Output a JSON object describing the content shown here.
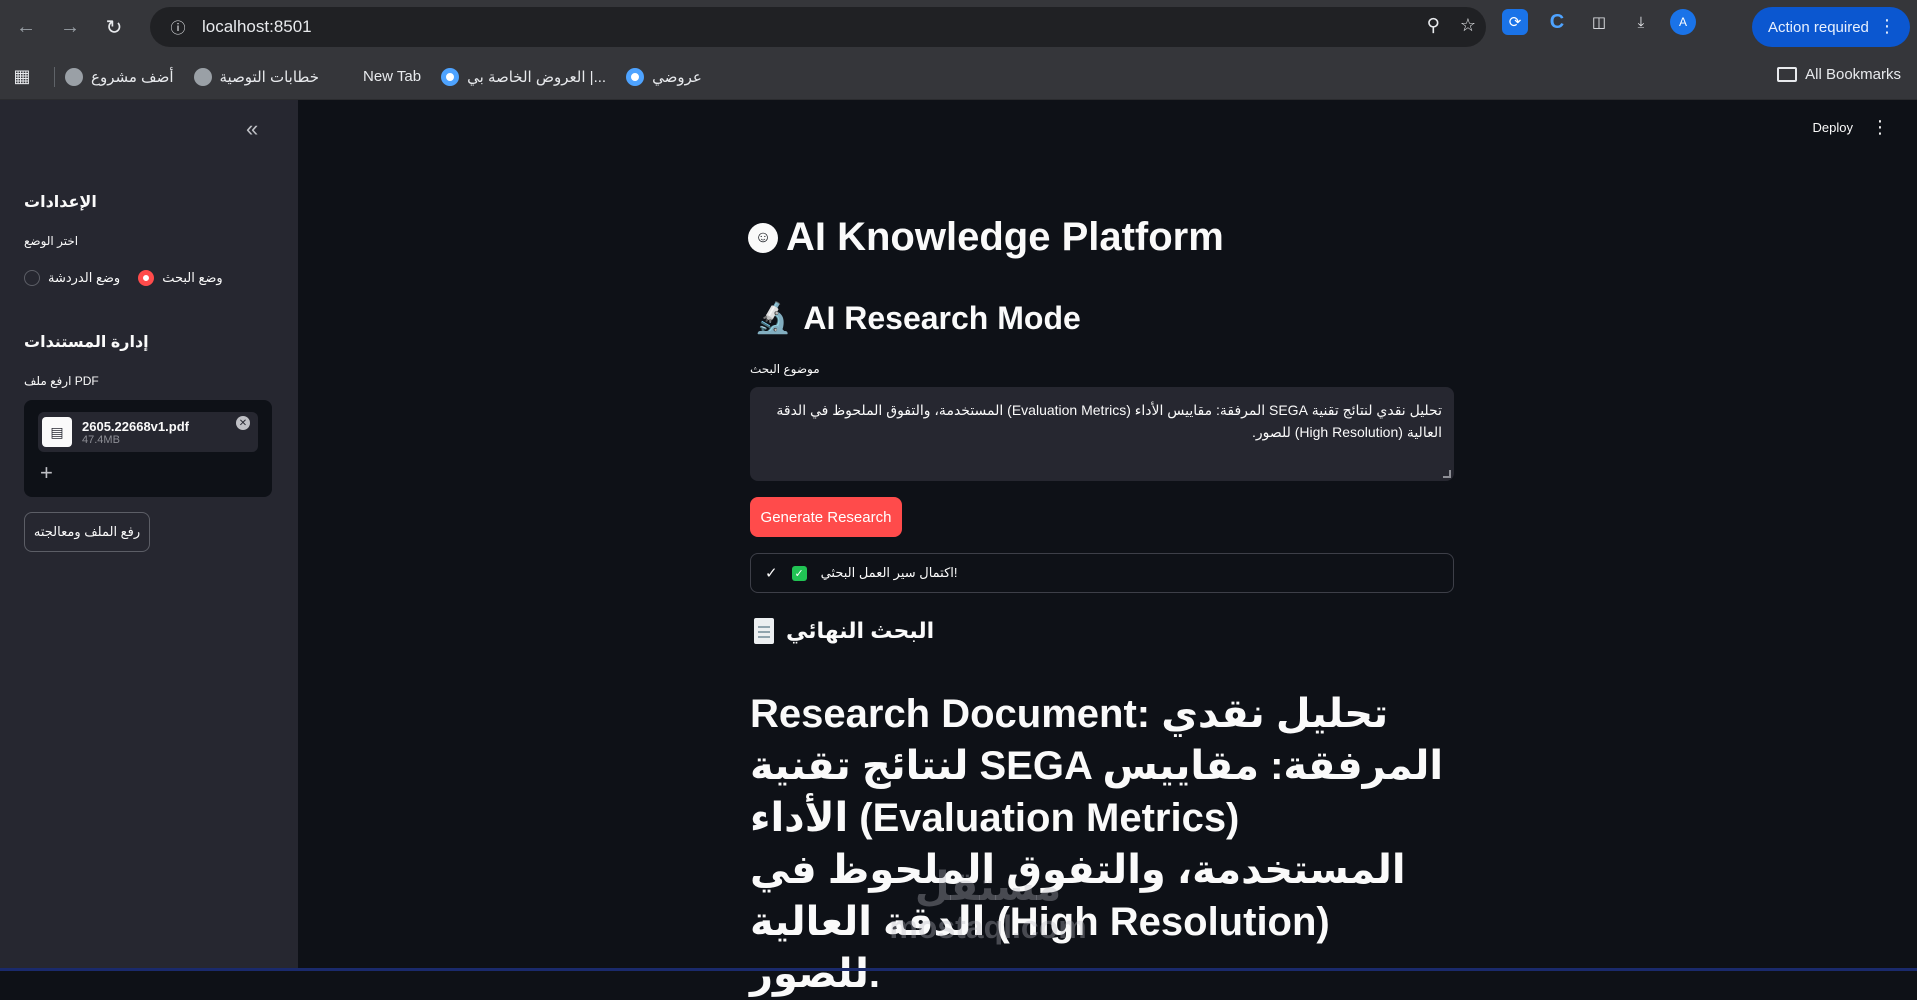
{
  "browser": {
    "url": "localhost:8501",
    "action_label": "Action required",
    "avatar_letter": "A",
    "bookmarks": [
      {
        "label": "أضف مشروع"
      },
      {
        "label": "خطابات التوصية"
      },
      {
        "label": "New Tab"
      },
      {
        "label": "العروض الخاصة بي |..."
      },
      {
        "label": "عروضي"
      }
    ],
    "all_bookmarks_label": "All Bookmarks"
  },
  "sidebar": {
    "settings_title": "الإعدادات",
    "mode_label": "اختر الوضع",
    "mode_options": [
      "وضع البحث",
      "وضع الدردشة"
    ],
    "selected_mode": "وضع البحث",
    "docs_title": "إدارة المستندات",
    "upload_label": "ارفع ملف PDF",
    "file_name": "2605.22668v1.pdf",
    "file_size": "47.4MB",
    "process_button": "رفع الملف ومعالجته"
  },
  "main": {
    "deploy_label": "Deploy",
    "title": "AI Knowledge Platform",
    "subtitle": "AI Research Mode",
    "topic_label": "موضوع البحث",
    "topic_value": "تحليل نقدي لنتائج تقنية SEGA المرفقة: مقاييس الأداء (Evaluation Metrics) المستخدمة، والتفوق الملحوظ في الدقة العالية (High Resolution) للصور.",
    "generate_button": "Generate Research",
    "status_text": "اكتمال سير العمل البحثي!",
    "final_heading": "البحث النهائي",
    "document_heading": "Research Document: تحليل نقدي لنتائج تقنية SEGA المرفقة: مقاييس الأداء (Evaluation Metrics) المستخدمة، والتفوق الملحوظ في الدقة العالية (High Resolution) للصور."
  },
  "watermark": {
    "arabic": "مستقل",
    "latin": "mostaql.com"
  }
}
